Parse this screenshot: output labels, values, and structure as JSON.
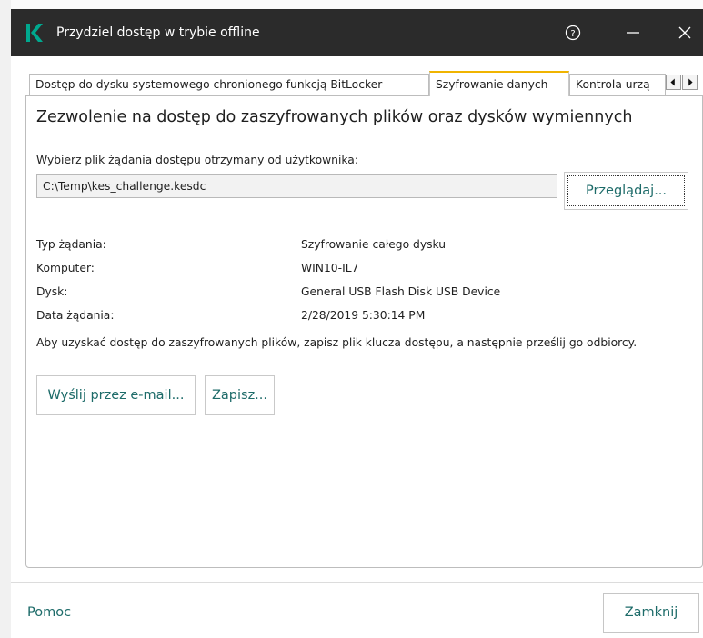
{
  "window": {
    "title": "Przydziel dostęp w trybie offline",
    "brand_color": "#00a88e",
    "titlebar_color": "#2b2b2b",
    "accent_link_color": "#1d6b69",
    "active_tab_color": "#f0b400"
  },
  "icons": {
    "logo": "kaspersky-k-logo",
    "help": "help-circle-icon",
    "minimize": "minimize-icon",
    "close": "close-icon",
    "scroll_left": "arrow-left-icon",
    "scroll_right": "arrow-right-icon"
  },
  "tabs": [
    {
      "label": "Dostęp do dysku systemowego chronionego funkcją BitLocker",
      "active": false
    },
    {
      "label": "Szyfrowanie danych",
      "active": true
    },
    {
      "label": "Kontrola urzą",
      "active": false
    }
  ],
  "panel": {
    "heading": "Zezwolenie na dostęp do zaszyfrowanych plików oraz dysków wymiennych",
    "file_label": "Wybierz plik żądania dostępu otrzymany od użytkownika:",
    "file_path": "C:\\Temp\\kes_challenge.kesdc",
    "browse_label": "Przeglądaj...",
    "details": [
      {
        "label": "Typ żądania:",
        "value": "Szyfrowanie całego dysku"
      },
      {
        "label": "Komputer:",
        "value": "WIN10-IL7"
      },
      {
        "label": "Dysk:",
        "value": "General USB Flash Disk USB Device"
      },
      {
        "label": "Data żądania:",
        "value": "2/28/2019 5:30:14 PM"
      }
    ],
    "info_text": "Aby uzyskać dostęp do zaszyfrowanych plików, zapisz plik klucza dostępu, a następnie prześlij go odbiorcy.",
    "email_label": "Wyślij przez e-mail...",
    "save_label": "Zapisz..."
  },
  "footer": {
    "help_label": "Pomoc",
    "close_label": "Zamknij"
  }
}
